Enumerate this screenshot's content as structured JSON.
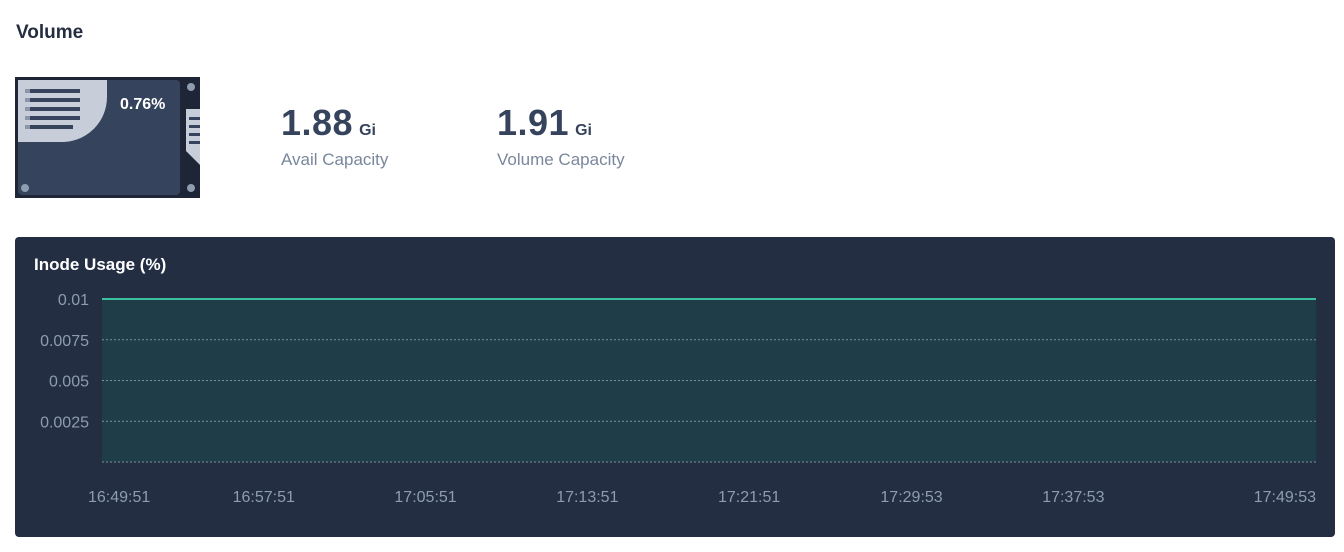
{
  "section": {
    "title": "Volume"
  },
  "disk": {
    "usage_percent": "0.76%"
  },
  "stats": [
    {
      "value": "1.88",
      "unit": "Gi",
      "label": "Avail Capacity"
    },
    {
      "value": "1.91",
      "unit": "Gi",
      "label": "Volume Capacity"
    }
  ],
  "chart_data": {
    "type": "area",
    "title": "Inode Usage (%)",
    "x": [
      "16:49:51",
      "16:57:51",
      "17:05:51",
      "17:13:51",
      "17:21:51",
      "17:29:53",
      "17:37:53",
      "17:49:53"
    ],
    "yticks": [
      "0.01",
      "0.0075",
      "0.005",
      "0.0025"
    ],
    "ylim": [
      0,
      0.01
    ],
    "series": [
      {
        "values": [
          0.01,
          0.01,
          0.01,
          0.01,
          0.01,
          0.01,
          0.01,
          0.01
        ]
      }
    ],
    "grid": true,
    "colors": {
      "line": "#3bc1a0",
      "fill": "#1f3d48",
      "grid": "#7e8ea3"
    }
  }
}
